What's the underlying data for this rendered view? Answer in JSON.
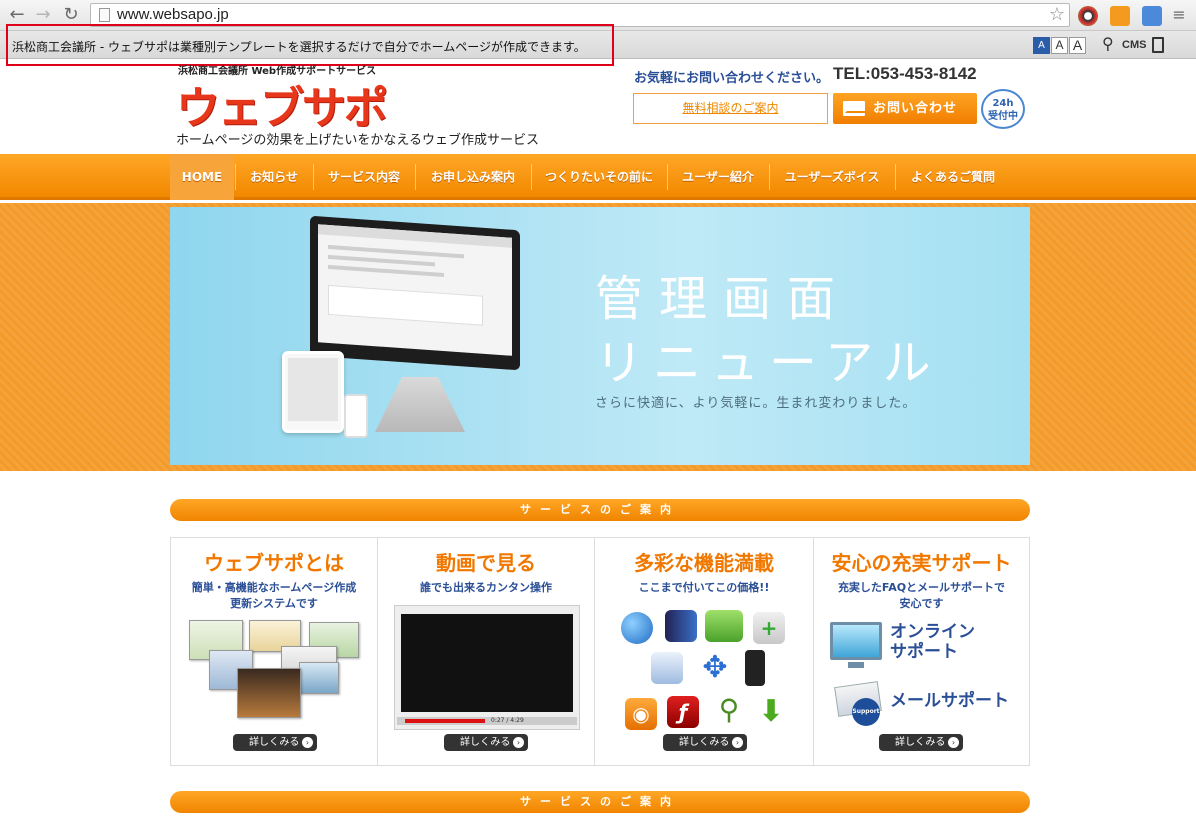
{
  "browser": {
    "url": "www.websapo.jp",
    "tooltip": "浜松商工会議所 - ウェブサポは業種別テンプレートを選択するだけで自分でホームページが作成できます。",
    "font_sizes": [
      "A",
      "A",
      "A"
    ],
    "cms_label": "CMS"
  },
  "header": {
    "logo_sub": "浜松商工会議所 Web作成サポートサービス",
    "logo_main": "ウェブサポ",
    "tagline": "ホームページの効果を上げたいをかなえるウェブ作成サービス",
    "contact_lead": "お気軽にお問い合わせください。",
    "tel": "TEL:053-453-8142",
    "consult_button": "無料相談のご案内",
    "inquiry_button": "お問い合わせ",
    "badge_line1": "24h",
    "badge_line2": "受付中"
  },
  "nav": {
    "items": [
      "HOME",
      "お知らせ",
      "サービス内容",
      "お申し込み案内",
      "つくりたいその前に",
      "ユーザー紹介",
      "ユーザーズボイス",
      "よくあるご質問"
    ]
  },
  "hero": {
    "title1": "管理画面",
    "title2": "リニューアル",
    "subtitle": "さらに快適に、より気軽に。生まれ変わりました。"
  },
  "sections": {
    "banner1": "サービスのご案内",
    "banner2": "サービスのご案内"
  },
  "cards": [
    {
      "title": "ウェブサポとは",
      "desc_line1": "簡単・高機能なホームページ作成",
      "desc_line2": "更新システムです",
      "more": "詳しくみる"
    },
    {
      "title": "動画で見る",
      "desc_line1": "誰でも出来るカンタン操作",
      "desc_line2": "",
      "more": "詳しくみる",
      "video_time": "0:27 / 4:29"
    },
    {
      "title": "多彩な機能満載",
      "desc_line1": "ここまで付いてこの価格!!",
      "desc_line2": "",
      "more": "詳しくみる"
    },
    {
      "title": "安心の充実サポート",
      "desc_line1": "充実したFAQとメールサポートで",
      "desc_line2": "安心です",
      "more": "詳しくみる",
      "online_line1": "オンライン",
      "online_line2": "サポート",
      "mail_support": "メールサポート",
      "support_badge": "Support"
    }
  ],
  "colors": {
    "accent": "#f28800",
    "logo": "#e8361a",
    "link_blue": "#2a4f96",
    "hero_bg": "#a9e2f3"
  }
}
